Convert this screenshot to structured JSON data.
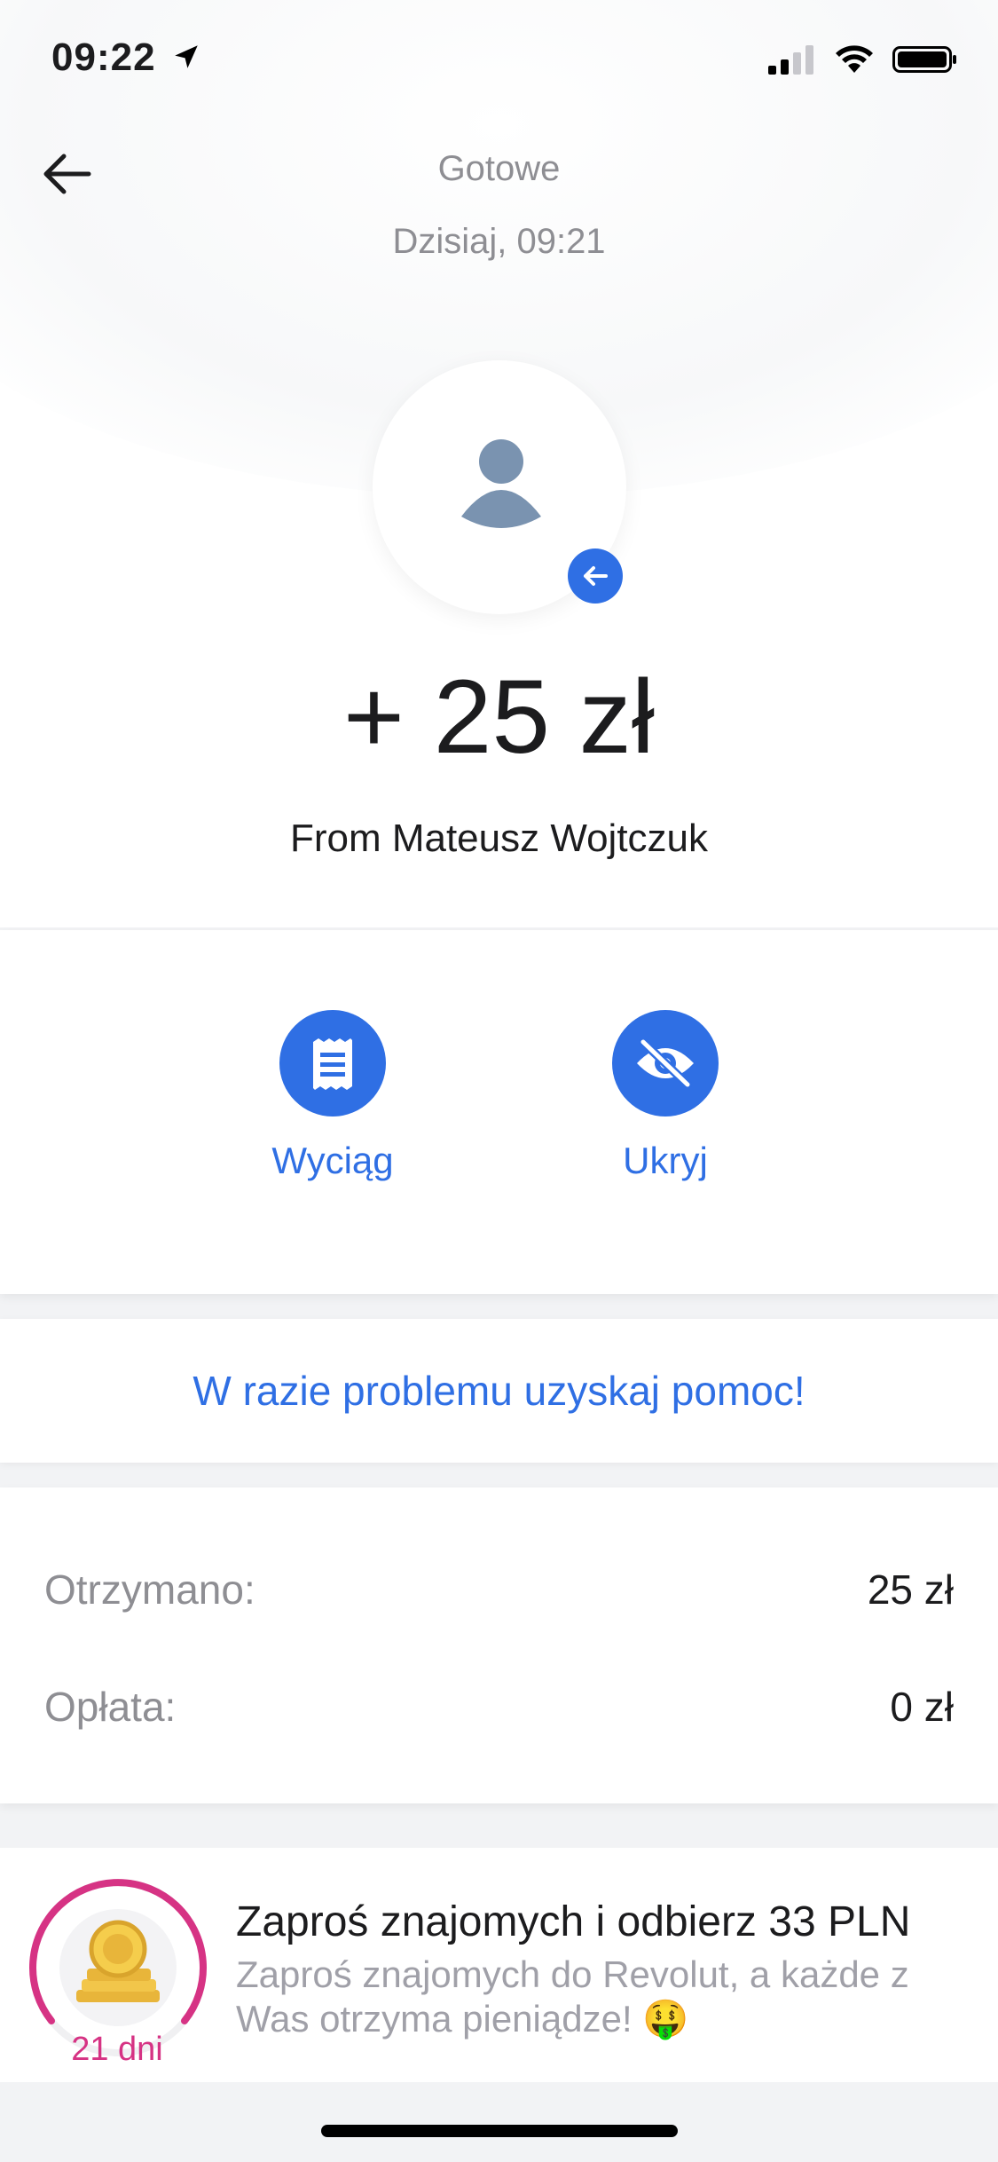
{
  "status_bar": {
    "time": "09:22"
  },
  "header": {
    "title": "Gotowe",
    "subtitle": "Dzisiaj, 09:21"
  },
  "transaction": {
    "amount": "+ 25 zł",
    "counterparty": "From Mateusz Wojtczuk"
  },
  "actions": [
    {
      "label": "Wyciąg",
      "icon": "receipt-icon"
    },
    {
      "label": "Ukryj",
      "icon": "eye-off-icon"
    }
  ],
  "help": {
    "link_text": "W razie problemu uzyskaj pomoc!"
  },
  "details": {
    "received_label": "Otrzymano:",
    "received_value": "25 zł",
    "fee_label": "Opłata:",
    "fee_value": "0 zł"
  },
  "referral": {
    "title": "Zaproś znajomych i odbierz 33 PLN",
    "description": "Zaproś znajomych do Revolut, a każde z Was otrzyma pieniądze! 🤑",
    "days_left": "21 dni",
    "ring_color": "#d63384"
  },
  "colors": {
    "accent": "#2f6fe4",
    "muted": "#8e8e93"
  }
}
